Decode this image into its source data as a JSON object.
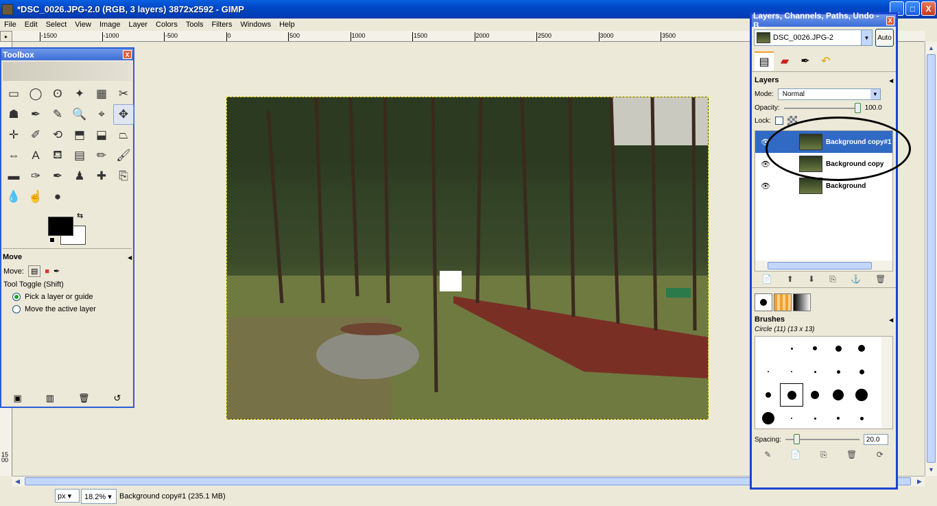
{
  "window": {
    "title": "*DSC_0026.JPG-2.0 (RGB, 3 layers) 3872x2592 - GIMP",
    "minimize_glyph": "_",
    "maximize_glyph": "□",
    "close_glyph": "X"
  },
  "menu": [
    "File",
    "Edit",
    "Select",
    "View",
    "Image",
    "Layer",
    "Colors",
    "Tools",
    "Filters",
    "Windows",
    "Help"
  ],
  "ruler": {
    "ticks": [
      "-1500",
      "-1000",
      "-500",
      "0",
      "500",
      "1000",
      "1500",
      "2000",
      "2500",
      "3000",
      "3500"
    ],
    "vertical_label": "1500"
  },
  "statusbar": {
    "unit": "px",
    "zoom": "18.2%",
    "message": "Background copy#1 (235.1 MB)"
  },
  "toolbox": {
    "title": "Toolbox",
    "close_glyph": "X",
    "tools": [
      "rect-select-icon",
      "ellipse-select-icon",
      "lasso-icon",
      "fuzzy-select-icon",
      "color-select-icon",
      "scissors-icon",
      "foreground-select-icon",
      "paths-icon",
      "color-picker-icon",
      "zoom-icon",
      "measure-icon",
      "move-icon",
      "align-icon",
      "crop-icon",
      "rotate-icon",
      "scale-icon",
      "shear-icon",
      "perspective-icon",
      "flip-icon",
      "text-icon",
      "bucket-fill-icon",
      "blend-icon",
      "pencil-icon",
      "paintbrush-icon",
      "eraser-icon",
      "airbrush-icon",
      "ink-icon",
      "clone-icon",
      "heal-icon",
      "perspective-clone-icon",
      "blur-icon",
      "smudge-icon",
      "dodge-burn-icon"
    ],
    "tool_glyphs": [
      "▭",
      "◯",
      "ʘ",
      "✦",
      "▦",
      "✂",
      "☗",
      "✒",
      "✎",
      "🔍",
      "⌖",
      "✥",
      "✛",
      "✐",
      "⟲",
      "⬒",
      "⬓",
      "⏢",
      "⇔",
      "A",
      "⛾",
      "▤",
      "✏",
      "🖌",
      "▬",
      "✑",
      "✒",
      "♟",
      "✚",
      "⎘",
      "💧",
      "☝",
      "●"
    ],
    "active_tool_index": 11,
    "options_title": "Move",
    "move_label": "Move:",
    "toggle_label": "Tool Toggle  (Shift)",
    "option_pick": "Pick a layer or guide",
    "option_move": "Move the active layer",
    "bottom_glyphs": [
      "▣",
      "▥",
      "🗑",
      "↺"
    ]
  },
  "dock": {
    "title": "Layers, Channels, Paths, Undo - B...",
    "close_glyph": "X",
    "image_name": "DSC_0026.JPG-2",
    "auto_label": "Auto",
    "tab_glyphs": [
      "▤",
      "▰",
      "✒",
      "↶"
    ],
    "layers_title": "Layers",
    "mode_label": "Mode:",
    "mode_value": "Normal",
    "opacity_label": "Opacity:",
    "opacity_value": "100.0",
    "opacity_fraction": 1.0,
    "lock_label": "Lock:",
    "layers": [
      {
        "name": "Background copy#1",
        "visible": true,
        "selected": true
      },
      {
        "name": "Background copy",
        "visible": true,
        "selected": false
      },
      {
        "name": "Background",
        "visible": true,
        "selected": false
      }
    ],
    "eye_glyph": "👁",
    "layer_buttons": [
      "📄",
      "⬆",
      "⬇",
      "⎘",
      "⚓",
      "🗑"
    ],
    "brushes_title": "Brushes",
    "brush_name": "Circle (11) (13 x 13)",
    "spacing_label": "Spacing:",
    "spacing_value": "20.0",
    "spacing_fraction": 0.2,
    "brush_buttons": [
      "✎",
      "📄",
      "⎘",
      "🗑",
      "⟳"
    ]
  },
  "colors": {
    "selected_row": "#316ac5",
    "title_bar": "#0048c8",
    "foreground": "#000000",
    "background": "#ffffff"
  }
}
